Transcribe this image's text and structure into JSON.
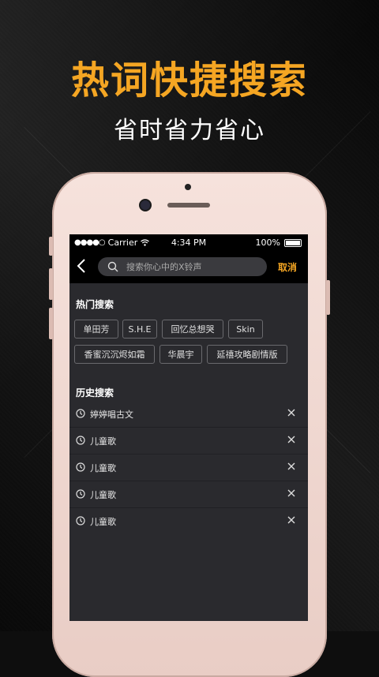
{
  "promo": {
    "headline": "热词快捷搜索",
    "subline": "省时省力省心"
  },
  "status_bar": {
    "signal": "●●●●○",
    "carrier": "Carrier",
    "time": "4:34 PM",
    "battery": "100%"
  },
  "nav": {
    "back_icon": "chevron-left-icon",
    "search_placeholder": "搜索你心中的X铃声",
    "cancel_label": "取消"
  },
  "hot": {
    "title": "热门搜索",
    "tags": [
      "单田芳",
      "S.H.E",
      "回忆总想哭",
      "Skin",
      "香蜜沉沉烬如霜",
      "华晨宇",
      "延禧攻略剧情版"
    ]
  },
  "history": {
    "title": "历史搜索",
    "items": [
      "婷婷唱古文",
      "儿童歌",
      "儿童歌",
      "儿童歌",
      "儿童歌"
    ]
  },
  "colors": {
    "accent": "#f5a623",
    "screen_bg": "#2a2a2e",
    "bar_bg": "#000000"
  }
}
